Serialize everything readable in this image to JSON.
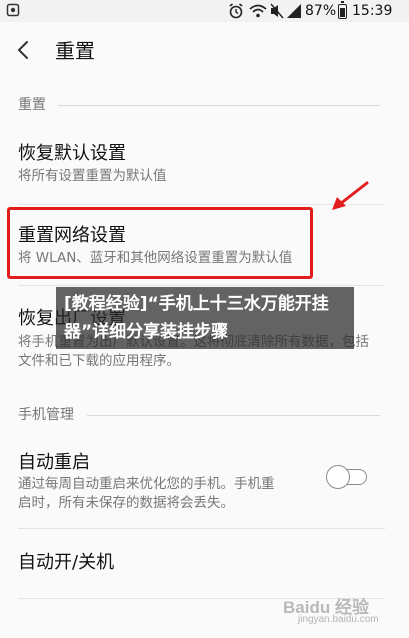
{
  "statusbar": {
    "battery": "87%",
    "time": "15:39"
  },
  "appbar": {
    "title": "重置"
  },
  "sections": {
    "reset_header": "重置",
    "phone_header": "手机管理"
  },
  "items": {
    "restore_default": {
      "title": "恢复默认设置",
      "subtitle": "将所有设置重置为默认值"
    },
    "reset_network": {
      "title": "重置网络设置",
      "subtitle": "将 WLAN、蓝牙和其他网络设置重置为默认值"
    },
    "factory_reset": {
      "title": "恢复出厂设置",
      "subtitle": "将手机重置为出厂默认设置。这将彻底清除所有数据，包括文件和已下载的应用程序。"
    },
    "auto_restart": {
      "title": "自动重启",
      "subtitle": "通过每周自动重启来优化您的手机。手机重启时，所有未保存的数据将会丢失。",
      "enabled": false
    },
    "auto_power": {
      "title": "自动开/关机"
    }
  },
  "overlay": {
    "banner_text": "[教程经验]“手机上十三水万能开挂器”详细分享装挂步骤"
  },
  "watermark": {
    "brand": "Baidu 经验",
    "url": "jingyan.baidu.com"
  },
  "colors": {
    "highlight": "#e11d1d",
    "background": "#fafafa",
    "secondary_text": "#777777"
  }
}
